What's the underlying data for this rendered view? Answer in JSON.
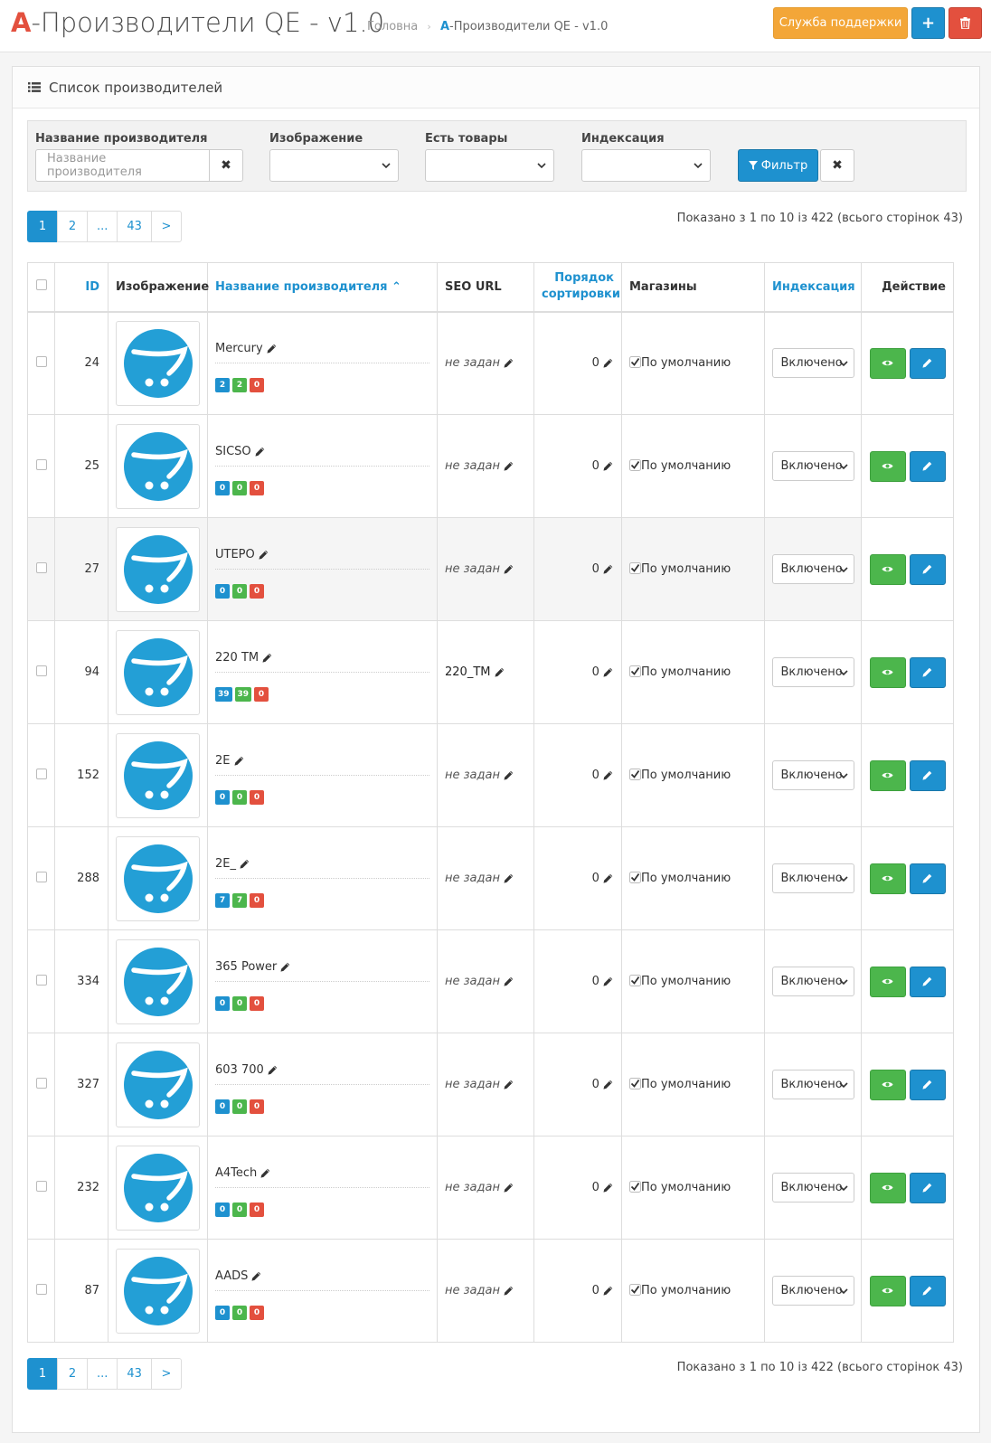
{
  "header": {
    "title_prefix": "A",
    "title_rest": "-Производители QE - v1.0",
    "breadcrumb": {
      "home": "Головна",
      "current_prefix": "A",
      "current_rest": "-Производители QE - v1.0"
    },
    "support_label": "Служба поддержки",
    "add_label": "+"
  },
  "panel": {
    "title": "Список производителей"
  },
  "filter": {
    "name_label": "Название производителя",
    "name_placeholder": "Название производителя",
    "image_label": "Изображение",
    "products_label": "Есть товары",
    "index_label": "Индексация",
    "filter_button": "Фильтр",
    "clear_glyph": "✖"
  },
  "pagination": {
    "pages": [
      "1",
      "2",
      "...",
      "43",
      ">"
    ],
    "active": "1"
  },
  "results_text": "Показано з 1 по 10 із 422 (всього сторінок 43)",
  "table": {
    "columns": {
      "id": "ID",
      "image": "Изображение",
      "name": "Название производителя",
      "name_sort_arrow": "⌃",
      "seo": "SEO URL",
      "sort_order_line1": "Порядок",
      "sort_order_line2": "сортировки",
      "stores": "Магазины",
      "indexing": "Индексация",
      "action": "Действие"
    },
    "rows": [
      {
        "id": "24",
        "name": "Mercury",
        "badges": [
          "2",
          "2",
          "0"
        ],
        "seo": "не задан",
        "seo_set": false,
        "sort": "0",
        "store": "По умолчанию",
        "index": "Включено"
      },
      {
        "id": "25",
        "name": "SICSO",
        "badges": [
          "0",
          "0",
          "0"
        ],
        "seo": "не задан",
        "seo_set": false,
        "sort": "0",
        "store": "По умолчанию",
        "index": "Включено"
      },
      {
        "id": "27",
        "name": "UTEPO",
        "badges": [
          "0",
          "0",
          "0"
        ],
        "seo": "не задан",
        "seo_set": false,
        "sort": "0",
        "store": "По умолчанию",
        "index": "Включено"
      },
      {
        "id": "94",
        "name": "220 TM",
        "badges": [
          "39",
          "39",
          "0"
        ],
        "seo": "220_TM",
        "seo_set": true,
        "sort": "0",
        "store": "По умолчанию",
        "index": "Включено"
      },
      {
        "id": "152",
        "name": "2E",
        "badges": [
          "0",
          "0",
          "0"
        ],
        "seo": "не задан",
        "seo_set": false,
        "sort": "0",
        "store": "По умолчанию",
        "index": "Включено"
      },
      {
        "id": "288",
        "name": "2E_",
        "badges": [
          "7",
          "7",
          "0"
        ],
        "seo": "не задан",
        "seo_set": false,
        "sort": "0",
        "store": "По умолчанию",
        "index": "Включено"
      },
      {
        "id": "334",
        "name": "365 Power",
        "badges": [
          "0",
          "0",
          "0"
        ],
        "seo": "не задан",
        "seo_set": false,
        "sort": "0",
        "store": "По умолчанию",
        "index": "Включено"
      },
      {
        "id": "327",
        "name": "603 700",
        "badges": [
          "0",
          "0",
          "0"
        ],
        "seo": "не задан",
        "seo_set": false,
        "sort": "0",
        "store": "По умолчанию",
        "index": "Включено"
      },
      {
        "id": "232",
        "name": "A4Tech",
        "badges": [
          "0",
          "0",
          "0"
        ],
        "seo": "не задан",
        "seo_set": false,
        "sort": "0",
        "store": "По умолчанию",
        "index": "Включено"
      },
      {
        "id": "87",
        "name": "AADS",
        "badges": [
          "0",
          "0",
          "0"
        ],
        "seo": "не задан",
        "seo_set": false,
        "sort": "0",
        "store": "По умолчанию",
        "index": "Включено"
      }
    ]
  },
  "colors": {
    "primary": "#1e91cf",
    "success": "#4cb64c",
    "danger": "#e3503e",
    "warning": "#f3a638"
  },
  "icons": {
    "delete": "trash-icon",
    "list": "list-icon",
    "filter": "funnel-icon",
    "edit": "pencil-icon",
    "view": "eye-icon",
    "logo": "opencart-cart-icon",
    "check": "checkmark-icon",
    "dropdown": "chevron-down-icon"
  }
}
